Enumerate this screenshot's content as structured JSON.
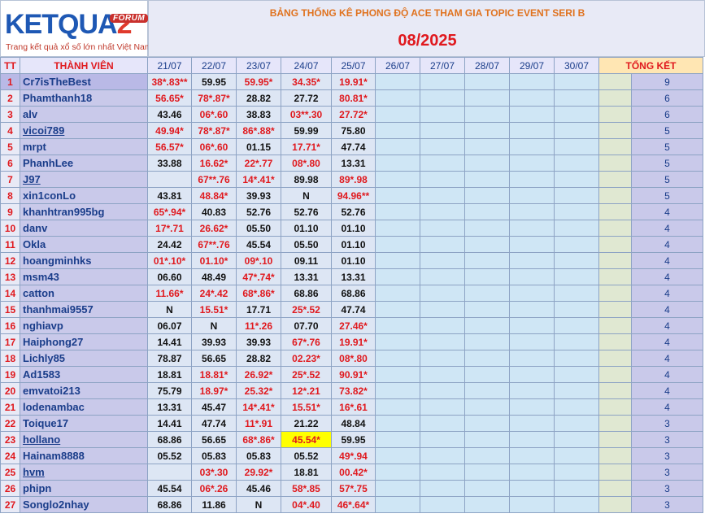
{
  "logo": {
    "forum": "FORUM",
    "text_a": "KETQUA",
    "text_b": "2",
    "slogan": "Trang kết quả xổ số lớn nhất Việt Nam"
  },
  "title": "BẢNG THỐNG KÊ PHONG ĐỘ ACE THAM GIA TOPIC EVENT SERI B",
  "month": "08/2025",
  "headers": {
    "tt": "TT",
    "member": "THÀNH VIÊN",
    "total": "TỔNG KẾT"
  },
  "days": [
    "21/07",
    "22/07",
    "23/07",
    "24/07",
    "25/07",
    "26/07",
    "27/07",
    "28/07",
    "29/07",
    "30/07"
  ],
  "rows": [
    {
      "tt": "1",
      "name": "Cr7isTheBest",
      "link": false,
      "vals": [
        "38*.83**",
        "59.95",
        "59.95*",
        "34.35*",
        "19.91*"
      ],
      "score": "9"
    },
    {
      "tt": "2",
      "name": "Phamthanh18",
      "link": false,
      "vals": [
        "56.65*",
        "78*.87*",
        "28.82",
        "27.72",
        "80.81*"
      ],
      "score": "6"
    },
    {
      "tt": "3",
      "name": "alv",
      "link": false,
      "vals": [
        "43.46",
        "06*.60",
        "38.83",
        "03**.30",
        "27.72*"
      ],
      "score": "6"
    },
    {
      "tt": "4",
      "name": "vicoi789",
      "link": true,
      "vals": [
        "49.94*",
        "78*.87*",
        "86*.88*",
        "59.99",
        "75.80"
      ],
      "score": "5"
    },
    {
      "tt": "5",
      "name": "mrpt",
      "link": false,
      "vals": [
        "56.57*",
        "06*.60",
        "01.15",
        "17.71*",
        "47.74"
      ],
      "score": "5"
    },
    {
      "tt": "6",
      "name": "PhanhLee",
      "link": false,
      "vals": [
        "33.88",
        "16.62*",
        "22*.77",
        "08*.80",
        "13.31"
      ],
      "score": "5"
    },
    {
      "tt": "7",
      "name": "J97",
      "link": true,
      "vals": [
        "",
        "67**.76",
        "14*.41*",
        "89.98",
        "89*.98"
      ],
      "score": "5"
    },
    {
      "tt": "8",
      "name": "xin1conLo",
      "link": false,
      "vals": [
        "43.81",
        "48.84*",
        "39.93",
        "N",
        "94.96**"
      ],
      "score": "5"
    },
    {
      "tt": "9",
      "name": "khanhtran995bg",
      "link": false,
      "vals": [
        "65*.94*",
        "40.83",
        "52.76",
        "52.76",
        "52.76"
      ],
      "score": "4"
    },
    {
      "tt": "10",
      "name": "danv",
      "link": false,
      "vals": [
        "17*.71",
        "26.62*",
        "05.50",
        "01.10",
        "01.10"
      ],
      "score": "4"
    },
    {
      "tt": "11",
      "name": "Okla",
      "link": false,
      "vals": [
        "24.42",
        "67**.76",
        "45.54",
        "05.50",
        "01.10"
      ],
      "score": "4"
    },
    {
      "tt": "12",
      "name": "hoangminhks",
      "link": false,
      "vals": [
        "01*.10*",
        "01.10*",
        "09*.10",
        "09.11",
        "01.10"
      ],
      "score": "4"
    },
    {
      "tt": "13",
      "name": "msm43",
      "link": false,
      "vals": [
        "06.60",
        "48.49",
        "47*.74*",
        "13.31",
        "13.31"
      ],
      "score": "4"
    },
    {
      "tt": "14",
      "name": "catton",
      "link": false,
      "vals": [
        "11.66*",
        "24*.42",
        "68*.86*",
        "68.86",
        "68.86"
      ],
      "score": "4"
    },
    {
      "tt": "15",
      "name": "thanhmai9557",
      "link": false,
      "vals": [
        "N",
        "15.51*",
        "17.71",
        "25*.52",
        "47.74"
      ],
      "score": "4"
    },
    {
      "tt": "16",
      "name": "nghiavp",
      "link": false,
      "vals": [
        "06.07",
        "N",
        "11*.26",
        "07.70",
        "27.46*"
      ],
      "score": "4"
    },
    {
      "tt": "17",
      "name": "Haiphong27",
      "link": false,
      "vals": [
        "14.41",
        "39.93",
        "39.93",
        "67*.76",
        "19.91*"
      ],
      "score": "4"
    },
    {
      "tt": "18",
      "name": "Lichly85",
      "link": false,
      "vals": [
        "78.87",
        "56.65",
        "28.82",
        "02.23*",
        "08*.80"
      ],
      "score": "4"
    },
    {
      "tt": "19",
      "name": "Ad1583",
      "link": false,
      "vals": [
        "18.81",
        "18.81*",
        "26.92*",
        "25*.52",
        "90.91*"
      ],
      "score": "4"
    },
    {
      "tt": "20",
      "name": "emvatoi213",
      "link": false,
      "vals": [
        "75.79",
        "18.97*",
        "25.32*",
        "12*.21",
        "73.82*"
      ],
      "score": "4"
    },
    {
      "tt": "21",
      "name": "lodenambac",
      "link": false,
      "vals": [
        "13.31",
        "45.47",
        "14*.41*",
        "15.51*",
        "16*.61"
      ],
      "score": "4"
    },
    {
      "tt": "22",
      "name": "Toique17",
      "link": false,
      "vals": [
        "14.41",
        "47.74",
        "11*.91",
        "21.22",
        "48.84"
      ],
      "score": "3"
    },
    {
      "tt": "23",
      "name": "hollano",
      "link": true,
      "vals": [
        "68.86",
        "56.65",
        "68*.86*",
        "45.54*",
        "59.95"
      ],
      "score": "3"
    },
    {
      "tt": "24",
      "name": "Hainam8888",
      "link": false,
      "vals": [
        "05.52",
        "05.83",
        "05.83",
        "05.52",
        "49*.94"
      ],
      "score": "3"
    },
    {
      "tt": "25",
      "name": "hvm",
      "link": true,
      "vals": [
        "",
        "03*.30",
        "29.92*",
        "18.81",
        "00.42*"
      ],
      "score": "3"
    },
    {
      "tt": "26",
      "name": "phipn",
      "link": false,
      "vals": [
        "45.54",
        "06*.26",
        "45.46",
        "58*.85",
        "57*.75"
      ],
      "score": "3"
    },
    {
      "tt": "27",
      "name": "Songlo2nhay",
      "link": false,
      "vals": [
        "68.86",
        "11.86",
        "N",
        "04*.40",
        "46*.64*"
      ],
      "score": "3"
    }
  ],
  "highlight": {
    "row": 23,
    "col": 3
  },
  "colors": {
    "red": "#e0191e",
    "navy": "#1a3d8a",
    "orange": "#e0721e",
    "highlight": "#ffff00"
  }
}
